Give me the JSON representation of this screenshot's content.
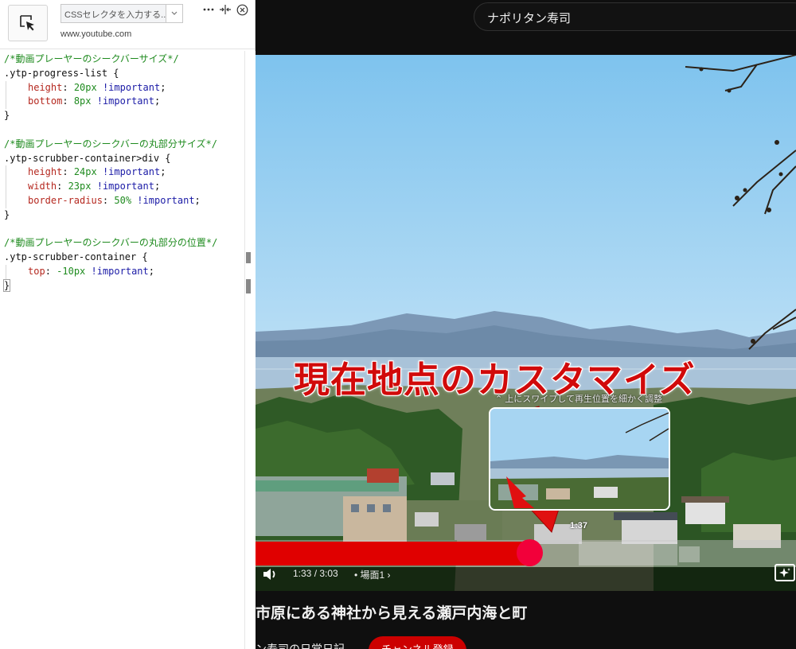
{
  "extension_panel": {
    "picker_icon": "element-picker-icon",
    "selector_placeholder": "CSSセレクタを入力する...",
    "host": "www.youtube.com",
    "header_icons": [
      "more-icon",
      "resize-icon",
      "close-icon"
    ],
    "code_lines": [
      {
        "type": "comment",
        "text": "/*動画プレーヤーのシークバーサイズ*/"
      },
      {
        "type": "selector",
        "text": ".ytp-progress-list {"
      },
      {
        "type": "decl",
        "prop": "height",
        "value": "20px",
        "important": "!important"
      },
      {
        "type": "decl",
        "prop": "bottom",
        "value": "8px",
        "important": "!important"
      },
      {
        "type": "close",
        "text": "}"
      },
      {
        "type": "blank",
        "text": ""
      },
      {
        "type": "comment",
        "text": "/*動画プレーヤーのシークバーの丸部分サイズ*/"
      },
      {
        "type": "selector",
        "text": ".ytp-scrubber-container>div {"
      },
      {
        "type": "decl",
        "prop": "height",
        "value": "24px",
        "important": "!important"
      },
      {
        "type": "decl",
        "prop": "width",
        "value": "23px",
        "important": "!important"
      },
      {
        "type": "decl",
        "prop": "border-radius",
        "value": "50%",
        "important": "!important"
      },
      {
        "type": "close",
        "text": "}"
      },
      {
        "type": "blank",
        "text": ""
      },
      {
        "type": "comment",
        "text": "/*動画プレーヤーのシークバーの丸部分の位置*/"
      },
      {
        "type": "selector",
        "text": ".ytp-scrubber-container {"
      },
      {
        "type": "decl",
        "prop": "top",
        "value": "-10px",
        "important": "!important"
      },
      {
        "type": "close",
        "text": "}"
      }
    ]
  },
  "youtube": {
    "search_query": "ナポリタン寿司",
    "overlay_caption": "現在地点のカスタマイズ",
    "seek_hint": "⌃ 上にスワイプして再生位置を細かく調整",
    "preview_time": "1:37",
    "time_display": "1:33 / 3:03",
    "chapter_label": "• 場面1 ›",
    "played_fraction": 0.509,
    "video_title": "市原にある神社から見える瀬戸内海と町",
    "channel_name": "ン寿司の日常日記",
    "subscribe_label": "チャンネル登録",
    "colors": {
      "progress": "#e00000",
      "scrubber": "#f2003a",
      "subscribe": "#cc0000",
      "caption": "#d10a0a"
    }
  }
}
